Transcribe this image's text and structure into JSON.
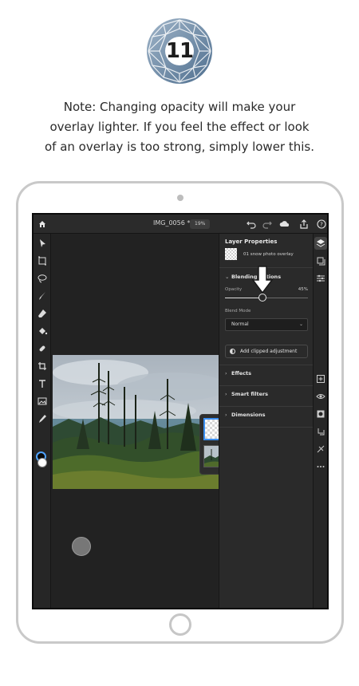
{
  "step": {
    "number": "11"
  },
  "note": {
    "text": "Note: Changing opacity will make your\noverlay lighter. If you feel the effect or look\nof an overlay is too strong, simply lower this."
  },
  "app": {
    "file_name": "IMG_0056 *",
    "zoom": "19%",
    "panel": {
      "title": "Layer Properties",
      "layer_name": "01 snow photo overlay",
      "blending_title": "Blending options",
      "opacity_label": "Opacity",
      "opacity_value": "45%",
      "opacity_fraction": 0.45,
      "blend_mode_label": "Blend Mode",
      "blend_mode_value": "Normal",
      "clipped_adjustment_label": "Add clipped adjustment",
      "sections": [
        "Effects",
        "Smart filters",
        "Dimensions"
      ]
    },
    "left_tools": [
      "select-icon",
      "transform-icon",
      "lasso-icon",
      "brush-icon",
      "eraser-icon",
      "paint-bucket-icon",
      "healing-icon",
      "crop-icon",
      "type-icon",
      "image-icon",
      "eyedropper-icon"
    ],
    "right_rail": [
      "layers-icon",
      "layer-properties-icon",
      "adjustments-icon",
      "add-layer-icon",
      "visibility-icon",
      "mask-icon",
      "clip-icon",
      "fx-icon",
      "more-icon"
    ]
  },
  "colors": {
    "accent": "#3b8ef0",
    "badge": "#5f7f9e",
    "app_bg": "#1f1f1f"
  }
}
